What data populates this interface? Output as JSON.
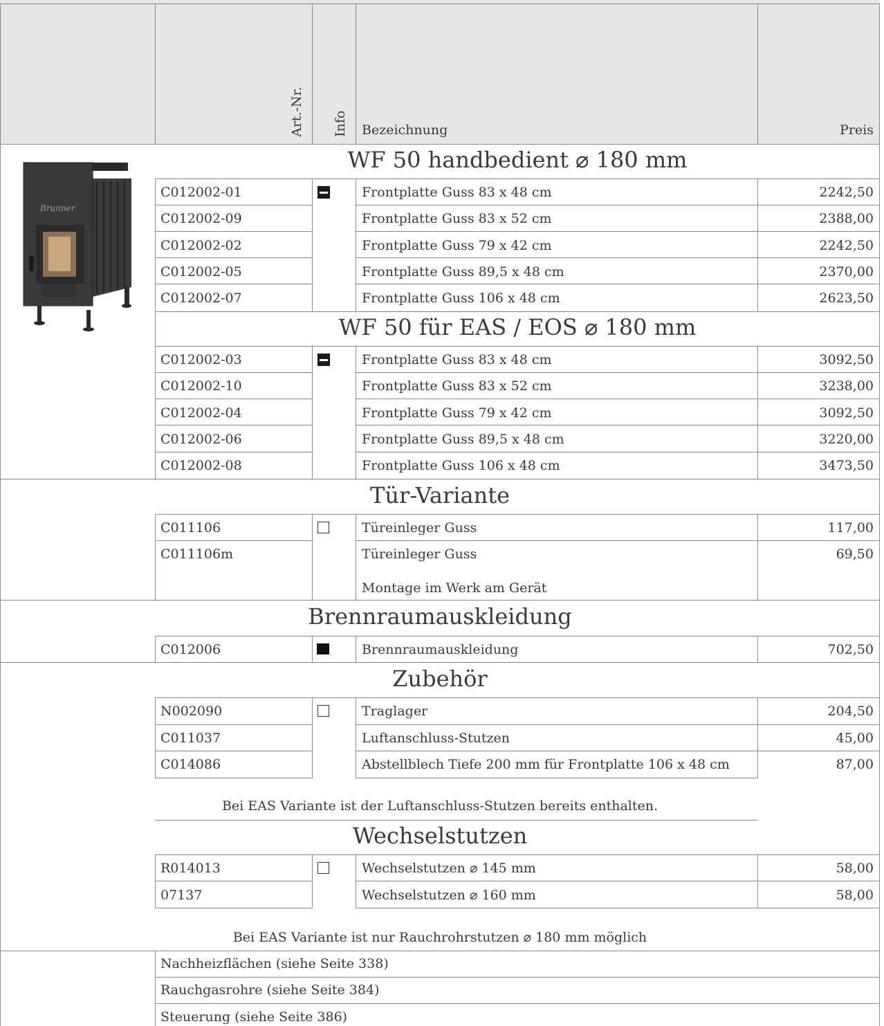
{
  "header": {
    "art_nr": "Art.-Nr.",
    "info": "Info",
    "bezeichnung": "Bezeichnung",
    "preis": "Preis"
  },
  "sections": {
    "s1": {
      "title": "WF 50 handbedient ⌀ 180 mm",
      "rows": [
        {
          "art": "C012002-01",
          "desc": "Frontplatte Guss 83 x 48 cm",
          "price": "2242,50"
        },
        {
          "art": "C012002-09",
          "desc": "Frontplatte Guss 83 x 52 cm",
          "price": "2388,00"
        },
        {
          "art": "C012002-02",
          "desc": "Frontplatte Guss 79 x 42 cm",
          "price": "2242,50"
        },
        {
          "art": "C012002-05",
          "desc": "Frontplatte Guss 89,5 x 48 cm",
          "price": "2370,00"
        },
        {
          "art": "C012002-07",
          "desc": "Frontplatte Guss 106 x 48 cm",
          "price": "2623,50"
        }
      ]
    },
    "s2": {
      "title": "WF 50 für EAS / EOS ⌀ 180 mm",
      "rows": [
        {
          "art": "C012002-03",
          "desc": "Frontplatte Guss 83 x 48 cm",
          "price": "3092,50"
        },
        {
          "art": "C012002-10",
          "desc": "Frontplatte Guss 83 x 52 cm",
          "price": "3238,00"
        },
        {
          "art": "C012002-04",
          "desc": "Frontplatte Guss 79 x 42 cm",
          "price": "3092,50"
        },
        {
          "art": "C012002-06",
          "desc": "Frontplatte Guss 89,5 x 48 cm",
          "price": "3220,00"
        },
        {
          "art": "C012002-08",
          "desc": "Frontplatte Guss 106 x 48 cm",
          "price": "3473,50"
        }
      ]
    },
    "s3": {
      "title": "Tür-Variante",
      "rows": [
        {
          "art": "C011106",
          "desc": "Türeinleger Guss",
          "price": "117,00"
        },
        {
          "art": "C011106m",
          "desc": "Türeinleger Guss",
          "desc2": "Montage im Werk am Gerät",
          "price": "69,50"
        }
      ]
    },
    "s4": {
      "title": "Brennraumauskleidung",
      "rows": [
        {
          "art": "C012006",
          "desc": "Brennraumauskleidung",
          "price": "702,50"
        }
      ]
    },
    "s5": {
      "title": "Zubehör",
      "rows": [
        {
          "art": "N002090",
          "desc": "Traglager",
          "price": "204,50"
        },
        {
          "art": "C011037",
          "desc": "Luftanschluss-Stutzen",
          "price": "45,00"
        },
        {
          "art": "C014086",
          "desc": "Abstellblech Tiefe 200 mm für Frontplatte 106 x 48 cm",
          "price": "87,00"
        }
      ],
      "note": "Bei EAS Variante ist der Luftanschluss-Stutzen bereits enthalten."
    },
    "s6": {
      "title": "Wechselstutzen",
      "rows": [
        {
          "art": "R014013",
          "desc": "Wechselstutzen ⌀ 145 mm",
          "price": "58,00"
        },
        {
          "art": "07137",
          "desc": "Wechselstutzen ⌀ 160 mm",
          "price": "58,00"
        }
      ],
      "note": "Bei EAS Variante ist nur Rauchrohrstutzen ⌀ 180 mm möglich"
    }
  },
  "references": [
    "Nachheizflächen (siehe Seite 338)",
    "Rauchgasrohre (siehe Seite 384)",
    "Steuerung (siehe Seite 386)"
  ],
  "icons": {
    "s1": "half-filled-square-icon",
    "s2": "half-filled-square-icon",
    "s3": "empty-square-icon",
    "s4": "filled-square-icon",
    "s5": "empty-square-icon",
    "s6": "empty-square-icon"
  }
}
